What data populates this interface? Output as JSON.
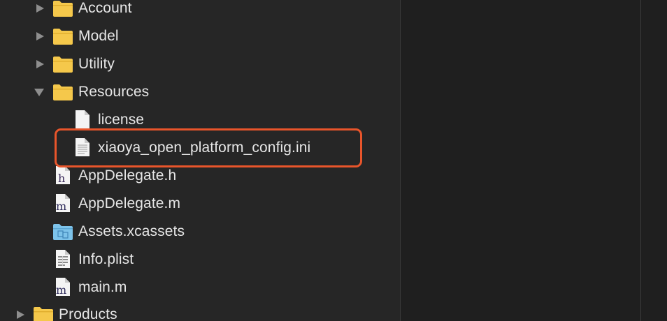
{
  "navigator": {
    "items": [
      {
        "label": "Account",
        "kind": "folder",
        "expanded": false
      },
      {
        "label": "Model",
        "kind": "folder",
        "expanded": false
      },
      {
        "label": "Utility",
        "kind": "folder",
        "expanded": false
      },
      {
        "label": "Resources",
        "kind": "folder",
        "expanded": true
      },
      {
        "label": "license",
        "kind": "file"
      },
      {
        "label": "xiaoya_open_platform_config.ini",
        "kind": "file-text"
      },
      {
        "label": "AppDelegate.h",
        "kind": "header-file",
        "glyph": "h"
      },
      {
        "label": "AppDelegate.m",
        "kind": "source-file",
        "glyph": "m"
      },
      {
        "label": "Assets.xcassets",
        "kind": "asset-catalog"
      },
      {
        "label": "Info.plist",
        "kind": "plist-file"
      },
      {
        "label": "main.m",
        "kind": "source-file",
        "glyph": "m"
      },
      {
        "label": "Products",
        "kind": "folder",
        "expanded": false
      }
    ]
  },
  "colors": {
    "highlight": "#e8552b",
    "folder": "#f5c84b",
    "text": "#e6e6e6"
  }
}
